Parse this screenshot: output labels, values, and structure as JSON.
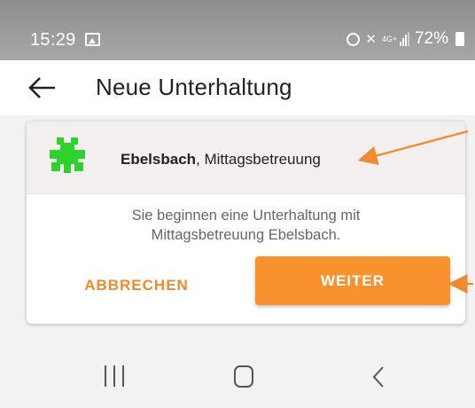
{
  "status_bar": {
    "time": "15:29",
    "network": "4G+",
    "battery": "72%",
    "icons": [
      "image-icon",
      "alarm-icon",
      "mute-icon",
      "network-icon",
      "signal-icon",
      "battery-icon"
    ]
  },
  "app_bar": {
    "back_icon": "arrow-left-icon",
    "title": "Neue Unterhaltung"
  },
  "dialog": {
    "recipient_bold": "Ebelsbach",
    "recipient_rest": ", Mittagsbetreuung",
    "message": "Sie beginnen eine Unterhaltung mit Mittagsbetreuung Ebelsbach.",
    "cancel_label": "ABBRECHEN",
    "continue_label": "WEITER"
  },
  "nav_bar": {
    "icons": [
      "recent-apps-icon",
      "home-icon",
      "back-icon"
    ]
  },
  "colors": {
    "accent": "#f7922e",
    "accent_text": "#f08a2a",
    "avatar_green": "#2ed12e",
    "annotation_arrow": "#f08a30",
    "status_bar": "#999999"
  }
}
